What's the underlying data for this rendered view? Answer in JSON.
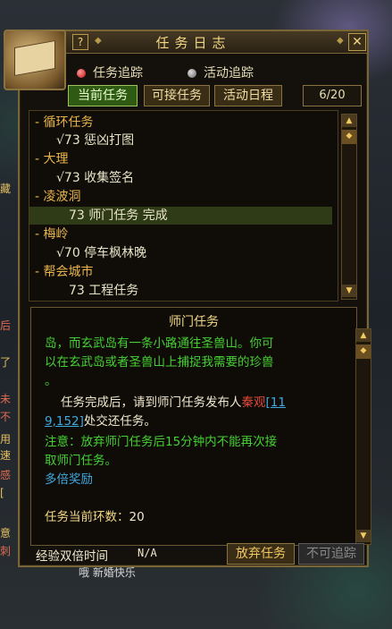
{
  "window": {
    "title": "任务日志",
    "help_glyph": "?",
    "close_glyph": "✕"
  },
  "tracking": {
    "quest_track_label": "任务追踪",
    "activity_track_label": "活动追踪"
  },
  "tabs": {
    "current": "当前任务",
    "available": "可接任务",
    "schedule": "活动日程",
    "count": "6/20"
  },
  "quest_list": [
    {
      "text": "- 循环任务",
      "kind": "category"
    },
    {
      "text": "√73 惩凶打图",
      "kind": "quest"
    },
    {
      "text": "- 大理",
      "kind": "category"
    },
    {
      "text": "√73 收集签名",
      "kind": "quest"
    },
    {
      "text": "- 凌波洞",
      "kind": "category"
    },
    {
      "text": "73 师门任务 完成",
      "kind": "quest_selected"
    },
    {
      "text": "- 梅岭",
      "kind": "category"
    },
    {
      "text": "√70 停车枫林晚",
      "kind": "quest"
    },
    {
      "text": "- 帮会城市",
      "kind": "category"
    },
    {
      "text": "73 工程任务",
      "kind": "quest"
    }
  ],
  "detail": {
    "title": "师门任务",
    "line1": "岛，而玄武岛有一条小路通往圣兽山。你可",
    "line2": "以在玄武岛或者圣兽山上捕捉我需要的珍兽",
    "line3": "。",
    "line4_a": "任务完成后，请到师门任务发布人",
    "line4_npc": "秦观",
    "line4_coord_1": "[11",
    "line5_coord_2": "9,152]",
    "line5_b": "处交还任务。",
    "line6": "注意：放弃师门任务后15分钟内不能再次接",
    "line7": "取师门任务。",
    "line8": "多倍奖励",
    "rounds_label": "任务当前环数：",
    "rounds_value": "20"
  },
  "bottom": {
    "exp_label": "经验双倍时间",
    "exp_value": "N/A",
    "abandon": "放弃任务",
    "untrack": "不可追踪"
  },
  "background": {
    "left_chars": [
      "藏",
      "后",
      "了",
      "未",
      "不",
      "用",
      "速",
      "感",
      "[",
      "意",
      "刺"
    ],
    "chat_text": "哦 新婚快乐"
  },
  "colors": {
    "panel_border": "#7a6536",
    "title_gold": "#f2d884",
    "quest_green": "#45d033",
    "link_cyan": "#3fa9e0",
    "npc_red": "#e04a3a",
    "selected_row": "#2f3a16"
  }
}
